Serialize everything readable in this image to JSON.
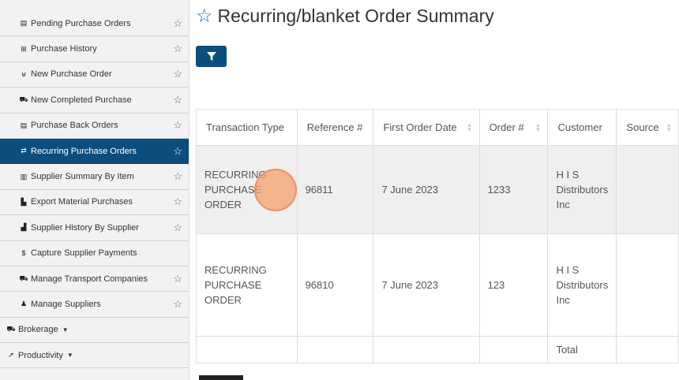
{
  "sidebar": {
    "items": [
      {
        "label": "Pending Purchase Orders",
        "icon": "clipboard-icon",
        "glyph": "▤",
        "star": true
      },
      {
        "label": "Purchase History",
        "icon": "table-icon",
        "glyph": "⊞",
        "star": true
      },
      {
        "label": "New Purchase Order",
        "icon": "cart-icon",
        "glyph": "⊎",
        "star": true
      },
      {
        "label": "New Completed Purchase",
        "icon": "truck-icon",
        "glyph": "⛟",
        "star": true
      },
      {
        "label": "Purchase Back Orders",
        "icon": "clipboard-icon",
        "glyph": "▤",
        "star": true
      },
      {
        "label": "Recurring Purchase Orders",
        "icon": "sync-icon",
        "glyph": "⇄",
        "star": true,
        "active": true
      },
      {
        "label": "Supplier Summary By Item",
        "icon": "barcode-icon",
        "glyph": "▥",
        "star": true
      },
      {
        "label": "Export Material Purchases",
        "icon": "file-export-icon",
        "glyph": "▙",
        "star": true
      },
      {
        "label": "Supplier History By Supplier",
        "icon": "chart-icon",
        "glyph": "▟",
        "star": true
      },
      {
        "label": "Capture Supplier Payments",
        "icon": "dollar-icon",
        "glyph": "$",
        "star": false
      },
      {
        "label": "Manage Transport Companies",
        "icon": "truck-icon",
        "glyph": "⛟",
        "star": true
      },
      {
        "label": "Manage Suppliers",
        "icon": "users-icon",
        "glyph": "♟",
        "star": true
      }
    ],
    "sections": [
      {
        "label": "Brokerage",
        "icon": "truck-icon",
        "glyph": "⛟"
      },
      {
        "label": "Productivity",
        "icon": "wrench-icon",
        "glyph": "➚"
      }
    ]
  },
  "page": {
    "title": "Recurring/blanket Order Summary"
  },
  "table": {
    "headers": [
      "Transaction Type",
      "Reference #",
      "First Order Date",
      "Order #",
      "Customer",
      "Source"
    ],
    "rows": [
      {
        "type": [
          "RECURRING",
          "PURCHASE",
          "ORDER"
        ],
        "reference": "96811",
        "date": "7 June 2023",
        "order": "1233",
        "customer": [
          "H I S",
          "Distributors",
          "Inc"
        ],
        "source": ""
      },
      {
        "type": [
          "RECURRING",
          "PURCHASE",
          "ORDER"
        ],
        "reference": "96810",
        "date": "7 June 2023",
        "order": "123",
        "customer": [
          "H I S",
          "Distributors",
          "Inc"
        ],
        "source": ""
      }
    ],
    "total_label": "Total"
  },
  "colors": {
    "accent": "#0b4e7e",
    "star": "#1a6fb0",
    "click_marker": "#f4a06e"
  }
}
